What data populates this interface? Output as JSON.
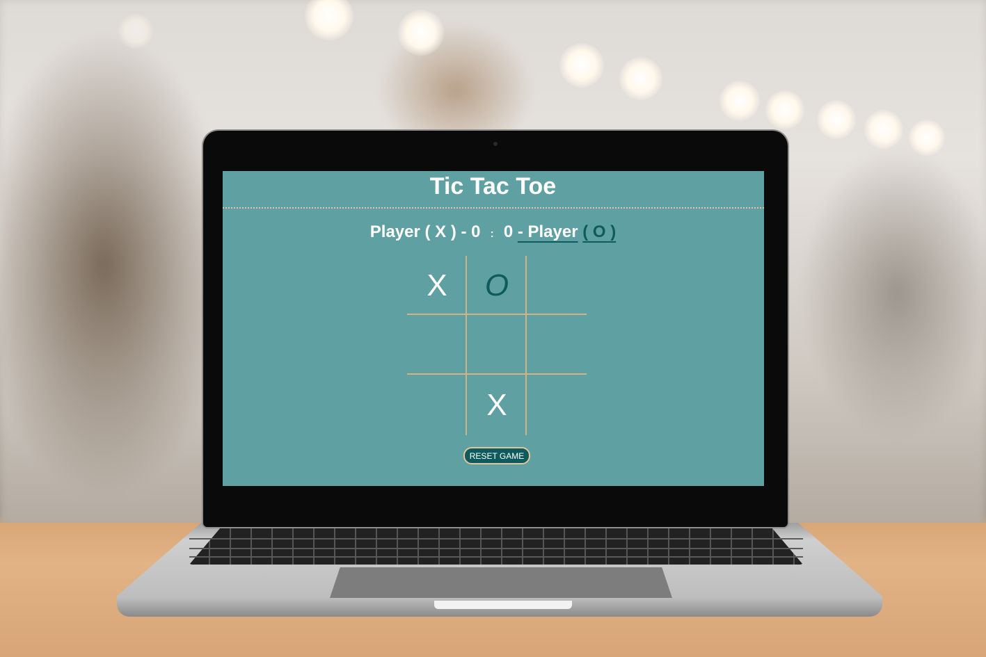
{
  "game": {
    "title": "Tic Tac Toe",
    "score": {
      "player1_label": "Player ( X ) - 0",
      "separator": ":",
      "player2_score": "0 ",
      "player2_label": "- Player",
      "player2_mark": "( O )"
    },
    "board": [
      [
        "X",
        "O",
        ""
      ],
      [
        "",
        "",
        ""
      ],
      [
        "",
        "X",
        ""
      ]
    ],
    "reset_label": "RESET GAME"
  },
  "colors": {
    "screen_bg": "#5fa0a2",
    "accent_dark_teal": "#0f5a5c",
    "grid_line": "#d3b383",
    "text": "#ffffff"
  }
}
